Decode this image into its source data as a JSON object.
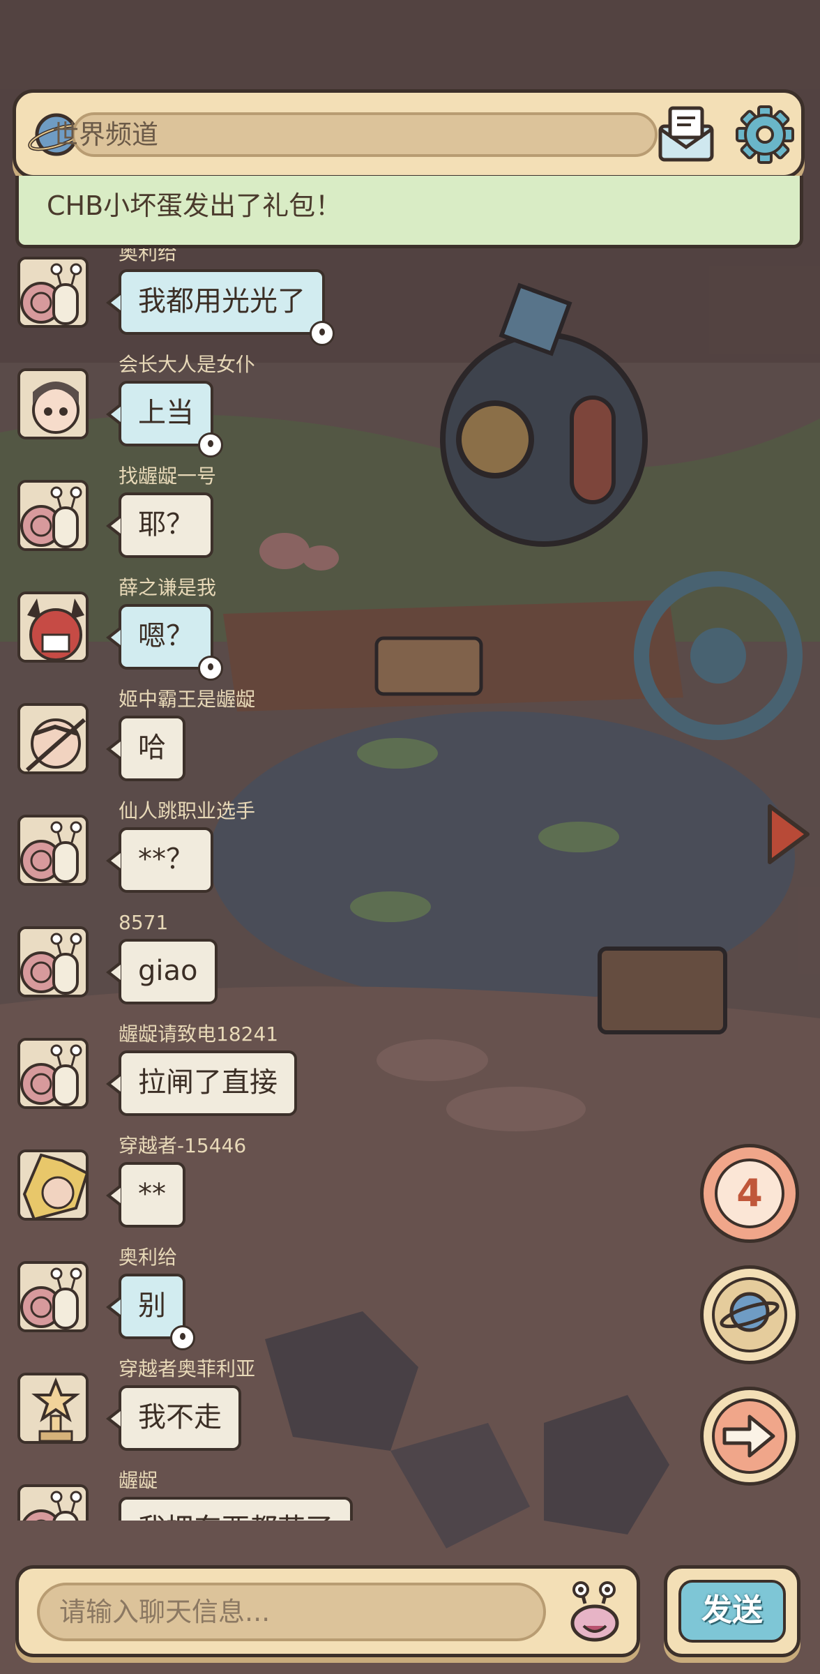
{
  "header": {
    "channel_title": "世界频道",
    "mail_icon": "mail-icon",
    "settings_icon": "gear-icon",
    "planet_icon": "planet-icon"
  },
  "system_banner": {
    "text": "CHB小坏蛋发出了礼包！"
  },
  "messages": [
    {
      "sender": "奥利给",
      "text": "我都用光光了",
      "style": "voice",
      "avatar": "snail-avatar"
    },
    {
      "sender": "会长大人是女仆",
      "text": "上当",
      "style": "voice",
      "avatar": "girl-avatar"
    },
    {
      "sender": "找龌龊一号",
      "text": "耶？",
      "style": "plain",
      "avatar": "snail-avatar"
    },
    {
      "sender": "薛之谦是我",
      "text": "嗯？",
      "style": "voice",
      "avatar": "demon-avatar"
    },
    {
      "sender": "姬中霸王是龌龊",
      "text": "哈",
      "style": "plain",
      "avatar": "warrior-avatar"
    },
    {
      "sender": "仙人跳职业选手",
      "text": "**？",
      "style": "plain",
      "avatar": "snail-avatar"
    },
    {
      "sender": "8571",
      "text": "giao",
      "style": "plain",
      "avatar": "snail-avatar"
    },
    {
      "sender": "龌龊请致电18241",
      "text": "拉闸了直接",
      "style": "plain",
      "avatar": "snail-avatar"
    },
    {
      "sender": "穿越者-15446",
      "text": "**",
      "style": "plain",
      "avatar": "blond-avatar"
    },
    {
      "sender": "奥利给",
      "text": "别",
      "style": "voice",
      "avatar": "snail-avatar"
    },
    {
      "sender": "穿越者奥菲利亚",
      "text": "我不走",
      "style": "plain",
      "avatar": "trophy-avatar"
    },
    {
      "sender": "龌龊",
      "text": "我把东西都花了",
      "style": "plain",
      "avatar": "snail-avatar"
    }
  ],
  "side_buttons": {
    "notification_count": "4",
    "world_icon": "planet-icon",
    "next_icon": "arrow-right-icon"
  },
  "input": {
    "placeholder": "请输入聊天信息...",
    "value": ""
  },
  "send_button": {
    "label": "发送"
  },
  "colors": {
    "panel": "#f3dfb6",
    "outline": "#3c302a",
    "banner": "#d9ecc5",
    "bubble_plain": "#f1ebdd",
    "bubble_voice": "#d2ecf0",
    "send": "#7ec6d6"
  }
}
